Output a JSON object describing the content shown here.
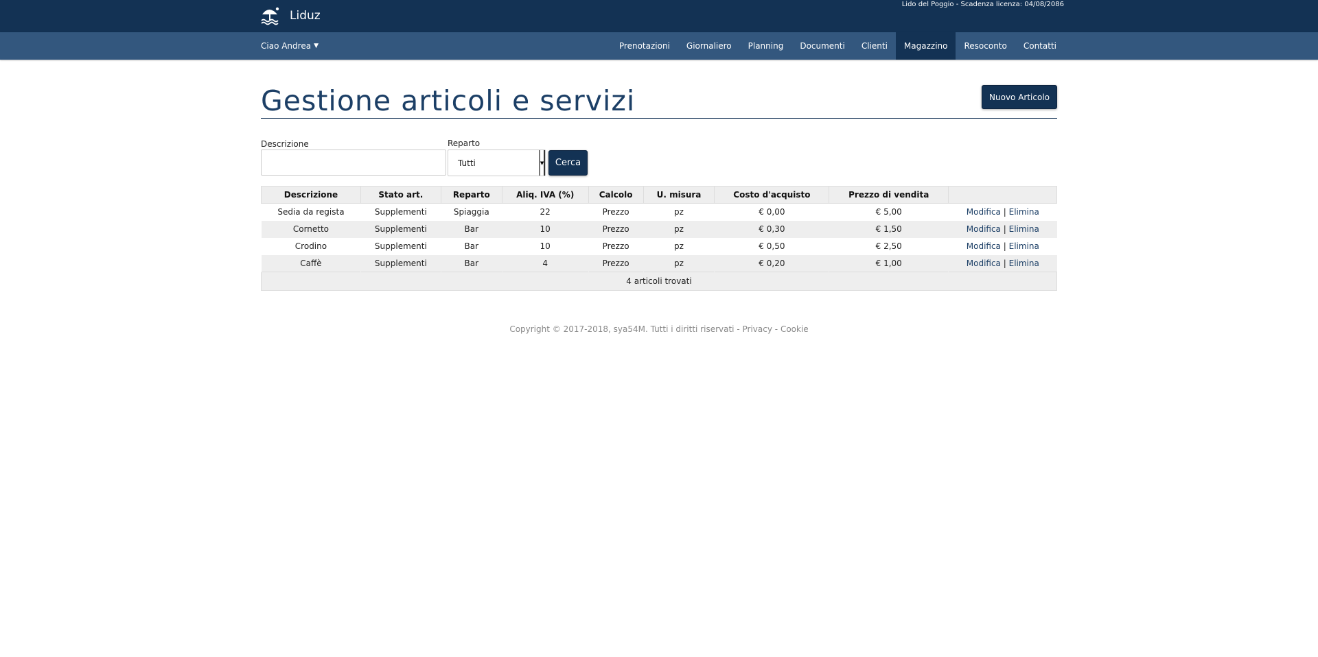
{
  "header": {
    "brand": "Liduz",
    "license": "Lido del Poggio - Scadenza licenza: 04/08/2086"
  },
  "nav": {
    "user": "Ciao Andrea",
    "items": [
      {
        "label": "Prenotazioni"
      },
      {
        "label": "Giornaliero"
      },
      {
        "label": "Planning"
      },
      {
        "label": "Documenti"
      },
      {
        "label": "Clienti"
      },
      {
        "label": "Magazzino",
        "active": true
      },
      {
        "label": "Resoconto"
      },
      {
        "label": "Contatti"
      }
    ]
  },
  "page": {
    "title": "Gestione articoli e servizi",
    "new_button": "Nuovo Articolo"
  },
  "search": {
    "desc_label": "Descrizione",
    "desc_value": "",
    "reparto_label": "Reparto",
    "reparto_value": "Tutti",
    "button": "Cerca"
  },
  "table": {
    "columns": [
      "Descrizione",
      "Stato art.",
      "Reparto",
      "Aliq. IVA (%)",
      "Calcolo",
      "U. misura",
      "Costo d'acquisto",
      "Prezzo di vendita",
      ""
    ],
    "rows": [
      {
        "descrizione": "Sedia da regista",
        "stato": "Supplementi",
        "reparto": "Spiaggia",
        "iva": "22",
        "calcolo": "Prezzo",
        "misura": "pz",
        "costo": "€ 0,00",
        "prezzo": "€ 5,00"
      },
      {
        "descrizione": "Cornetto",
        "stato": "Supplementi",
        "reparto": "Bar",
        "iva": "10",
        "calcolo": "Prezzo",
        "misura": "pz",
        "costo": "€ 0,30",
        "prezzo": "€ 1,50"
      },
      {
        "descrizione": "Crodino",
        "stato": "Supplementi",
        "reparto": "Bar",
        "iva": "10",
        "calcolo": "Prezzo",
        "misura": "pz",
        "costo": "€ 0,50",
        "prezzo": "€ 2,50"
      },
      {
        "descrizione": "Caffè",
        "stato": "Supplementi",
        "reparto": "Bar",
        "iva": "4",
        "calcolo": "Prezzo",
        "misura": "pz",
        "costo": "€ 0,20",
        "prezzo": "€ 1,00"
      }
    ],
    "edit_label": "Modifica",
    "delete_label": "Elimina",
    "separator": "|",
    "footer": "4 articoli trovati"
  },
  "footer": {
    "copyright": "Copyright © 2017-2018, sya54M. Tutti i diritti riservati",
    "dash": "-",
    "privacy": "Privacy",
    "cookie": "Cookie"
  },
  "colors": {
    "topbar": "#133254",
    "navbar": "#33577e",
    "accent": "#1c3f66"
  }
}
